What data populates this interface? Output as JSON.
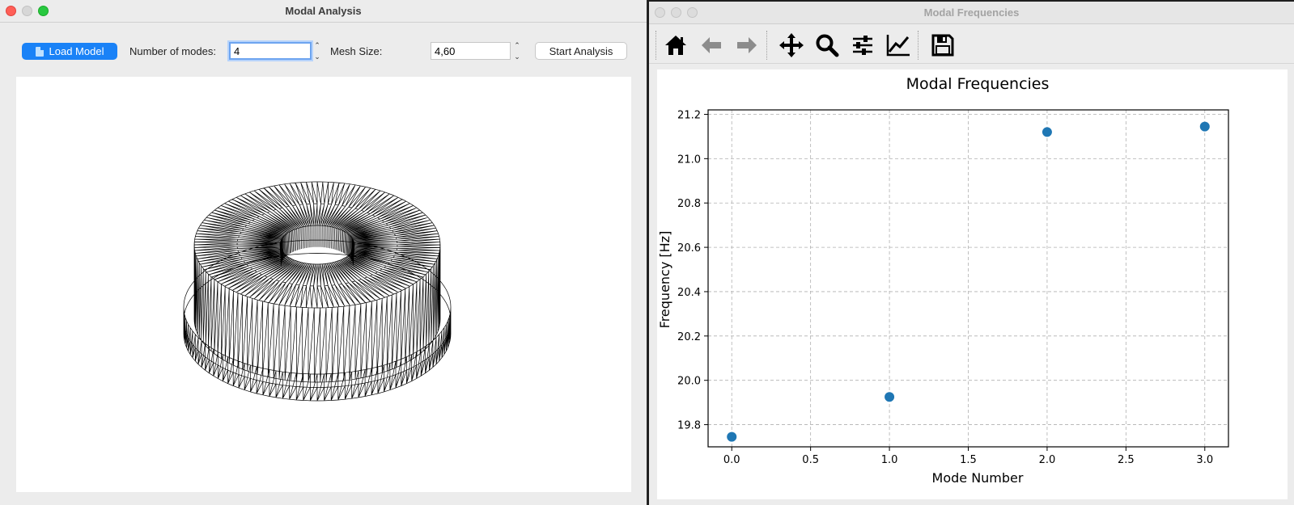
{
  "left_window": {
    "title": "Modal Analysis",
    "load_button": "Load Model",
    "modes_label": "Number of modes:",
    "modes_value": "4",
    "mesh_label": "Mesh Size:",
    "mesh_value": "4,60",
    "start_button": "Start Analysis"
  },
  "right_window": {
    "title": "Modal Frequencies",
    "toolbar": [
      "home-icon",
      "back-arrow-icon",
      "forward-arrow-icon",
      "pan-icon",
      "zoom-icon",
      "configure-subplots-icon",
      "edit-axis-icon",
      "save-icon"
    ]
  },
  "chart_data": {
    "type": "scatter",
    "title": "Modal Frequencies",
    "xlabel": "Mode Number",
    "ylabel": "Frequency [Hz]",
    "x": [
      0,
      1,
      2,
      3
    ],
    "y": [
      19.745,
      19.925,
      21.12,
      21.145
    ],
    "xlim": [
      -0.15,
      3.15
    ],
    "ylim": [
      19.7,
      21.22
    ],
    "xticks": [
      0.0,
      0.5,
      1.0,
      1.5,
      2.0,
      2.5,
      3.0
    ],
    "xtick_labels": [
      "0.0",
      "0.5",
      "1.0",
      "1.5",
      "2.0",
      "2.5",
      "3.0"
    ],
    "yticks": [
      19.8,
      20.0,
      20.2,
      20.4,
      20.6,
      20.8,
      21.0,
      21.2
    ],
    "ytick_labels": [
      "19.8",
      "20.0",
      "20.2",
      "20.4",
      "20.6",
      "20.8",
      "21.0",
      "21.2"
    ],
    "grid": true,
    "marker_color": "#1f77b4"
  }
}
